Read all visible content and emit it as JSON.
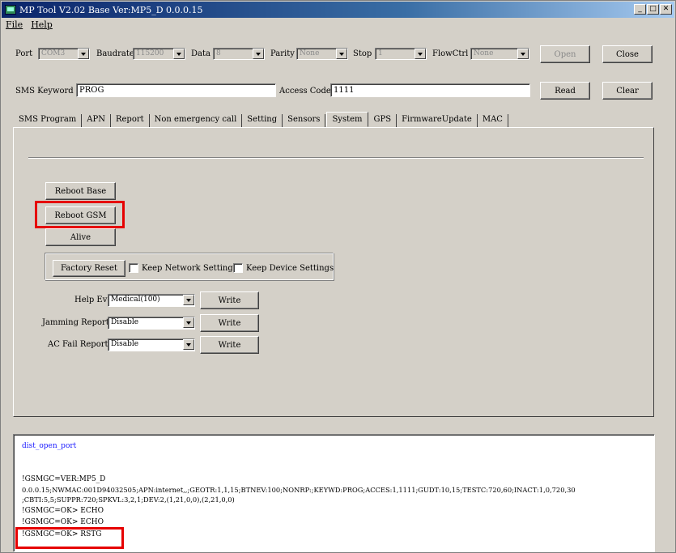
{
  "window": {
    "title": "MP Tool V2.02  Base Ver:MP5_D 0.0.0.15",
    "min_label": "_",
    "max_label": "□",
    "close_label": "✕"
  },
  "menu": {
    "file": "File",
    "help": "Help"
  },
  "port_row": {
    "port_label": "Port",
    "port_value": "COM3",
    "baud_label": "Baudrate",
    "baud_value": "115200",
    "data_label": "Data",
    "data_value": "8",
    "parity_label": "Parity",
    "parity_value": "None",
    "stop_label": "Stop",
    "stop_value": "1",
    "flow_label": "FlowCtrl",
    "flow_value": "None",
    "open_label": "Open",
    "close_label": "Close"
  },
  "sms_row": {
    "keyword_label": "SMS Keyword",
    "keyword_value": "PROG",
    "access_label": "Access Code",
    "access_value": "1111",
    "read_label": "Read",
    "clear_label": "Clear"
  },
  "tabs": [
    {
      "label": "SMS Program"
    },
    {
      "label": "APN"
    },
    {
      "label": "Report"
    },
    {
      "label": "Non emergency call"
    },
    {
      "label": "Setting"
    },
    {
      "label": "Sensors"
    },
    {
      "label": "System"
    },
    {
      "label": "GPS"
    },
    {
      "label": "FirmwareUpdate"
    },
    {
      "label": "MAC"
    }
  ],
  "system": {
    "reboot_base": "Reboot Base",
    "reboot_gsm": "Reboot GSM",
    "alive": "Alive",
    "factory_reset": "Factory Reset",
    "keep_network": "Keep Network Settings",
    "keep_device": "Keep Device Settings",
    "help_event_label": "Help Event",
    "help_event_value": "Medical(100)",
    "jamming_label": "Jamming Report",
    "jamming_value": "Disable",
    "acfail_label": "AC Fail Report",
    "acfail_value": "Disable",
    "write": "Write"
  },
  "log": {
    "lines": [
      "dist_open_port",
      "!GSMGC=VER:MP5_D",
      "0.0.0.15;NWMAC:001D94032505;APN:internet,,;GEOTR:1,1,15;BTNEV:100;NONRP:;KEYWD:PROG;ACCES:1,1111;GUDT:10,15;TESTC:720,60;INACT:1,0,720,30",
      ";CBTI:5,5;SUPPR:720;SPKVL:3,2,1;DEV:2,(1,21,0,0),(2,21,0,0)",
      "!GSMGC=OK> ECHO",
      "!GSMGC=OK> ECHO",
      "!GSMGC=OK> RSTG"
    ]
  },
  "colors": {
    "highlight": "#e60000",
    "log_link": "#1a1aff"
  }
}
